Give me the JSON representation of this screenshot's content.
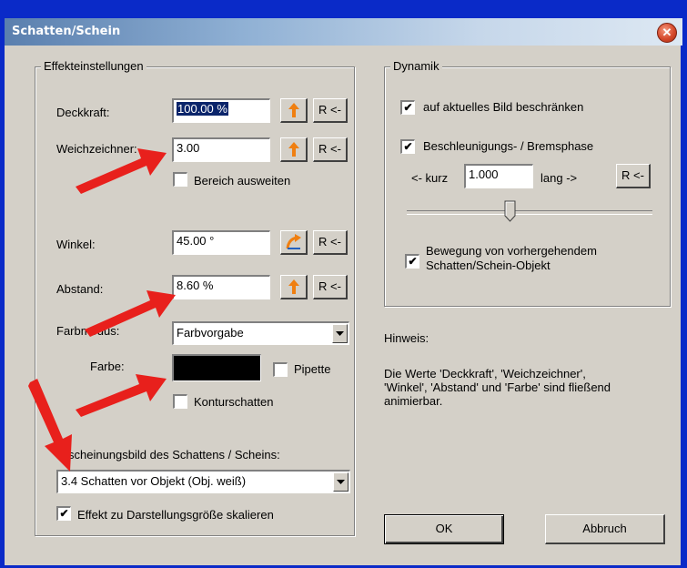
{
  "window": {
    "title": "Schatten/Schein",
    "close_glyph": "✕"
  },
  "effekt": {
    "legend": "Effekteinstellungen",
    "deckkraft": {
      "label": "Deckkraft:",
      "value": "100.00 %",
      "reset": "R <-"
    },
    "weichzeichner": {
      "label": "Weichzeichner:",
      "value": "3.00",
      "reset": "R <-"
    },
    "bereich": {
      "label": "Bereich ausweiten",
      "checked": false
    },
    "winkel": {
      "label": "Winkel:",
      "value": "45.00 °",
      "reset": "R <-"
    },
    "abstand": {
      "label": "Abstand:",
      "value": "8.60 %",
      "reset": "R <-"
    },
    "farbmodus": {
      "label": "Farbmodus:",
      "value": "Farbvorgabe"
    },
    "farbe": {
      "label": "Farbe:",
      "color": "#000000"
    },
    "pipette": {
      "label": "Pipette",
      "checked": false
    },
    "kontur": {
      "label": "Konturschatten",
      "checked": false
    },
    "erscheinung": {
      "label": "Erscheinungsbild des Schattens / Scheins:",
      "value": "3.4 Schatten vor Objekt (Obj. weiß)"
    },
    "skalieren": {
      "label": "Effekt zu Darstellungsgröße skalieren",
      "checked": true
    }
  },
  "dynamik": {
    "legend": "Dynamik",
    "beschraenken": {
      "label": "auf aktuelles Bild beschränken",
      "checked": true
    },
    "beschleunigung": {
      "label": "Beschleunigungs- / Bremsphase",
      "checked": true
    },
    "kurz_label": "<- kurz",
    "kurz_value": "1.000",
    "lang_label": "lang ->",
    "reset": "R <-",
    "slider_fraction": 0.42,
    "bewegung": {
      "line1": "Bewegung von vorhergehendem",
      "line2": "Schatten/Schein-Objekt",
      "checked": true
    }
  },
  "hinweis": {
    "title": "Hinweis:",
    "line1": "Die Werte 'Deckkraft', 'Weichzeichner',",
    "line2": "'Winkel', 'Abstand' und 'Farbe' sind fließend",
    "line3": "animierbar."
  },
  "buttons": {
    "ok": "OK",
    "cancel": "Abbruch"
  },
  "icons": {
    "keyframe": "orange-up-arrow-icon",
    "curve": "curve-arrow-icon",
    "dropdown": "triangle-down-icon",
    "check": "checkmark-icon"
  },
  "colors": {
    "annotation_arrow": "#e8201c",
    "accent_orange": "#f07f10",
    "title_blue": "#5a7fae"
  }
}
